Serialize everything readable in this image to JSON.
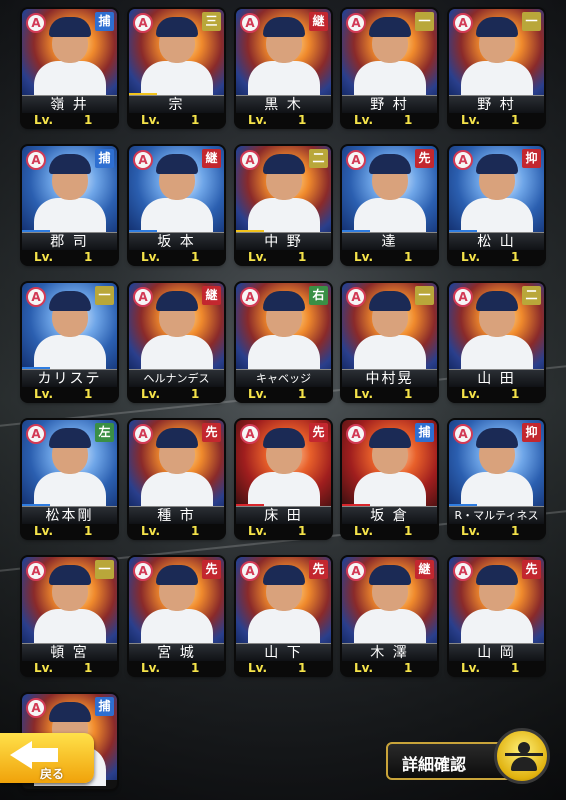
{
  "cards": [
    {
      "name": "嶺 井",
      "pos": "捕",
      "pos_type": "c",
      "level_label": "Lv.",
      "level": "1",
      "stripe": "",
      "bg": ""
    },
    {
      "name": "宗",
      "pos": "三",
      "pos_type": "i",
      "level_label": "Lv.",
      "level": "1",
      "stripe": "y",
      "bg": ""
    },
    {
      "name": "黒 木",
      "pos": "継",
      "pos_type": "r",
      "level_label": "Lv.",
      "level": "1",
      "stripe": "",
      "bg": ""
    },
    {
      "name": "野 村",
      "pos": "一",
      "pos_type": "i",
      "level_label": "Lv.",
      "level": "1",
      "stripe": "",
      "bg": ""
    },
    {
      "name": "野 村",
      "pos": "一",
      "pos_type": "i",
      "level_label": "Lv.",
      "level": "1",
      "stripe": "",
      "bg": ""
    },
    {
      "name": "郡 司",
      "pos": "捕",
      "pos_type": "c",
      "level_label": "Lv.",
      "level": "1",
      "stripe": "b",
      "bg": "blue"
    },
    {
      "name": "坂 本",
      "pos": "継",
      "pos_type": "r",
      "level_label": "Lv.",
      "level": "1",
      "stripe": "b",
      "bg": "blue"
    },
    {
      "name": "中 野",
      "pos": "二",
      "pos_type": "i",
      "level_label": "Lv.",
      "level": "1",
      "stripe": "y",
      "bg": ""
    },
    {
      "name": "達",
      "pos": "先",
      "pos_type": "r",
      "level_label": "Lv.",
      "level": "1",
      "stripe": "b",
      "bg": "blue"
    },
    {
      "name": "松 山",
      "pos": "抑",
      "pos_type": "r",
      "level_label": "Lv.",
      "level": "1",
      "stripe": "b",
      "bg": "blue"
    },
    {
      "name": "カリステ",
      "pos": "一",
      "pos_type": "i",
      "level_label": "Lv.",
      "level": "1",
      "stripe": "b",
      "bg": "blue"
    },
    {
      "name": "ヘルナンデス",
      "pos": "継",
      "pos_type": "r",
      "level_label": "Lv.",
      "level": "1",
      "stripe": "",
      "bg": ""
    },
    {
      "name": "キャベッジ",
      "pos": "右",
      "pos_type": "o",
      "level_label": "Lv.",
      "level": "1",
      "stripe": "",
      "bg": ""
    },
    {
      "name": "中村晃",
      "pos": "一",
      "pos_type": "i",
      "level_label": "Lv.",
      "level": "1",
      "stripe": "",
      "bg": ""
    },
    {
      "name": "山 田",
      "pos": "二",
      "pos_type": "i",
      "level_label": "Lv.",
      "level": "1",
      "stripe": "",
      "bg": ""
    },
    {
      "name": "松本剛",
      "pos": "左",
      "pos_type": "o",
      "level_label": "Lv.",
      "level": "1",
      "stripe": "b",
      "bg": "blue"
    },
    {
      "name": "種 市",
      "pos": "先",
      "pos_type": "r",
      "level_label": "Lv.",
      "level": "1",
      "stripe": "",
      "bg": ""
    },
    {
      "name": "床 田",
      "pos": "先",
      "pos_type": "r",
      "level_label": "Lv.",
      "level": "1",
      "stripe": "r2",
      "bg": "red"
    },
    {
      "name": "坂 倉",
      "pos": "捕",
      "pos_type": "c",
      "level_label": "Lv.",
      "level": "1",
      "stripe": "r2",
      "bg": "red"
    },
    {
      "name": "R・マルティネス",
      "pos": "抑",
      "pos_type": "r",
      "level_label": "Lv.",
      "level": "1",
      "stripe": "b",
      "bg": "blue"
    },
    {
      "name": "頓 宮",
      "pos": "一",
      "pos_type": "i",
      "level_label": "Lv.",
      "level": "1",
      "stripe": "",
      "bg": ""
    },
    {
      "name": "宮 城",
      "pos": "先",
      "pos_type": "r",
      "level_label": "Lv.",
      "level": "1",
      "stripe": "",
      "bg": ""
    },
    {
      "name": "山 下",
      "pos": "先",
      "pos_type": "r",
      "level_label": "Lv.",
      "level": "1",
      "stripe": "",
      "bg": ""
    },
    {
      "name": "木 澤",
      "pos": "継",
      "pos_type": "r",
      "level_label": "Lv.",
      "level": "1",
      "stripe": "",
      "bg": ""
    },
    {
      "name": "山 岡",
      "pos": "先",
      "pos_type": "r",
      "level_label": "Lv.",
      "level": "1",
      "stripe": "",
      "bg": ""
    },
    {
      "name": "",
      "pos": "捕",
      "pos_type": "c",
      "level_label": "",
      "level": "",
      "stripe": "",
      "bg": ""
    }
  ],
  "rarity_badge": "A",
  "back_button": {
    "label": "戻る"
  },
  "detail_button": {
    "label": "詳細確認"
  }
}
